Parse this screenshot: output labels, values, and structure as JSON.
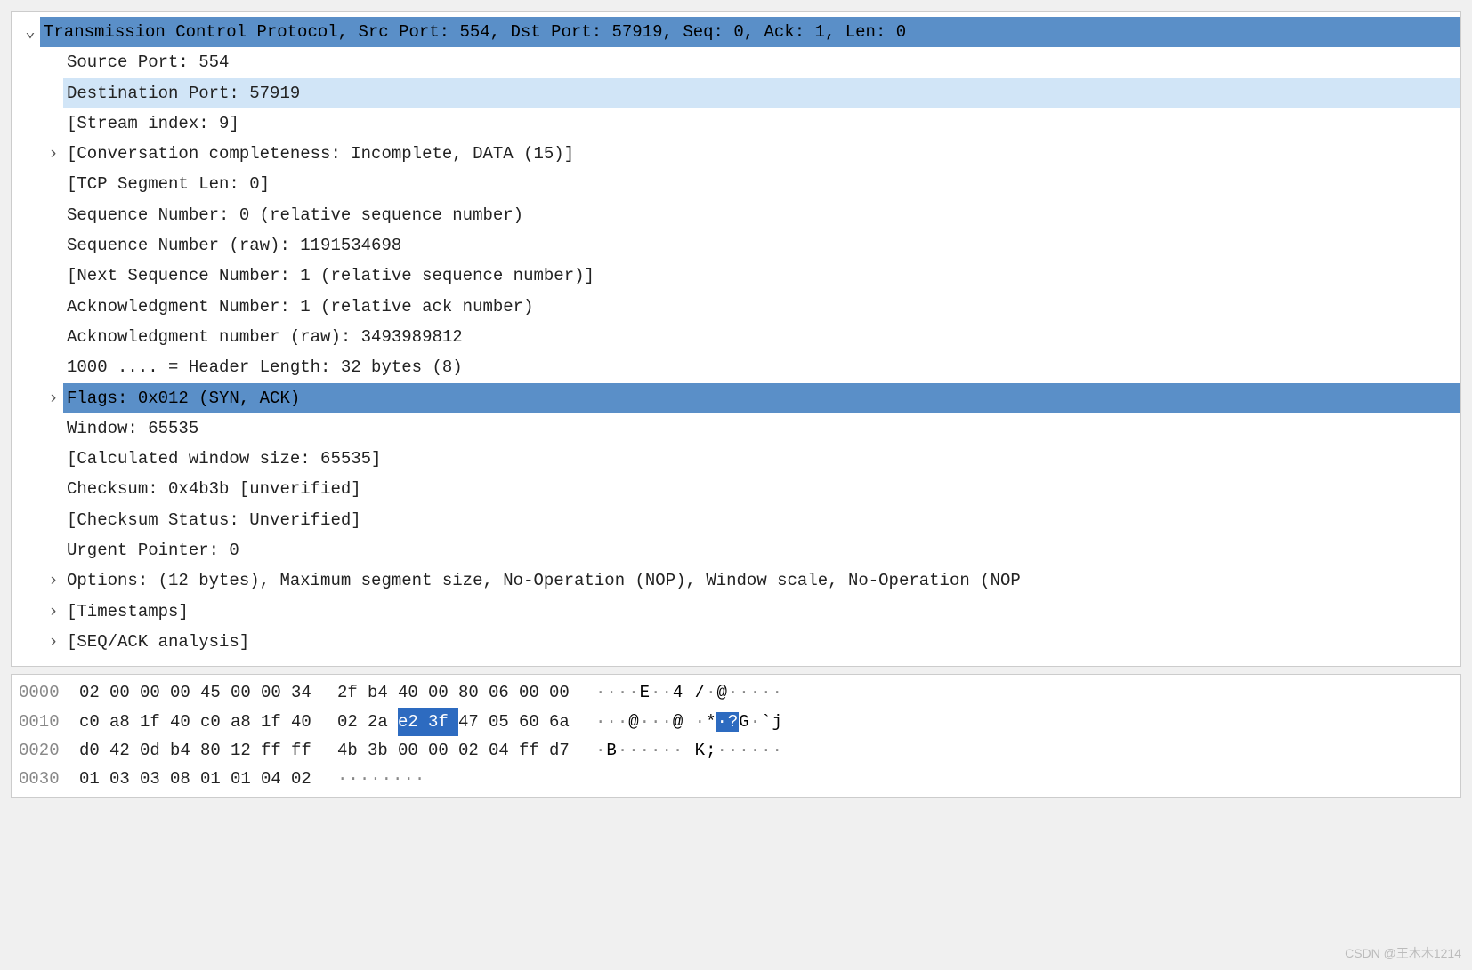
{
  "details": {
    "header": "Transmission Control Protocol, Src Port: 554, Dst Port: 57919, Seq: 0, Ack: 1, Len: 0",
    "source_port": "Source Port: 554",
    "dest_port": "Destination Port: 57919",
    "stream_index": "[Stream index: 9]",
    "conv_complete": "[Conversation completeness: Incomplete, DATA (15)]",
    "tcp_seg_len": "[TCP Segment Len: 0]",
    "seq_num": "Sequence Number: 0    (relative sequence number)",
    "seq_num_raw": "Sequence Number (raw): 1191534698",
    "next_seq": "[Next Sequence Number: 1    (relative sequence number)]",
    "ack_num": "Acknowledgment Number: 1    (relative ack number)",
    "ack_num_raw": "Acknowledgment number (raw): 3493989812",
    "header_len": "1000 .... = Header Length: 32 bytes (8)",
    "flags": "Flags: 0x012 (SYN, ACK)",
    "window": "Window: 65535",
    "calc_window": "[Calculated window size: 65535]",
    "checksum": "Checksum: 0x4b3b [unverified]",
    "checksum_status": "[Checksum Status: Unverified]",
    "urgent": "Urgent Pointer: 0",
    "options": "Options: (12 bytes), Maximum segment size, No-Operation (NOP), Window scale, No-Operation (NOP",
    "timestamps": "[Timestamps]",
    "seq_ack": "[SEQ/ACK analysis]"
  },
  "hex": {
    "rows": [
      {
        "offset": "0000",
        "b": [
          "02",
          "00",
          "00",
          "00",
          "45",
          "00",
          "00",
          "34",
          "2f",
          "b4",
          "40",
          "00",
          "80",
          "06",
          "00",
          "00"
        ],
        "ascii": "····E··4 /·@·····",
        "hl": []
      },
      {
        "offset": "0010",
        "b": [
          "c0",
          "a8",
          "1f",
          "40",
          "c0",
          "a8",
          "1f",
          "40",
          "02",
          "2a",
          "e2",
          "3f",
          "47",
          "05",
          "60",
          "6a"
        ],
        "ascii": "···@···@ ·*·?G·`j",
        "hl": [
          10,
          11
        ]
      },
      {
        "offset": "0020",
        "b": [
          "d0",
          "42",
          "0d",
          "b4",
          "80",
          "12",
          "ff",
          "ff",
          "4b",
          "3b",
          "00",
          "00",
          "02",
          "04",
          "ff",
          "d7"
        ],
        "ascii": "·B······ K;······",
        "hl": []
      },
      {
        "offset": "0030",
        "b": [
          "01",
          "03",
          "03",
          "08",
          "01",
          "01",
          "04",
          "02"
        ],
        "ascii": "········",
        "hl": []
      }
    ]
  },
  "watermark": "CSDN @王木木1214",
  "icons": {
    "down": "⌄",
    "right": "›"
  }
}
